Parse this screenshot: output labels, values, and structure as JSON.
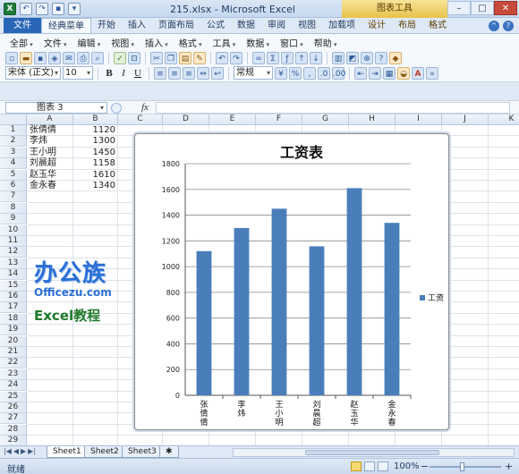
{
  "window": {
    "title": "215.xlsx - Microsoft Excel",
    "context_tab_group": "图表工具"
  },
  "ribbon_tabs": [
    {
      "label": "文件",
      "kind": "file"
    },
    {
      "label": "经典菜单",
      "kind": "active"
    },
    {
      "label": "开始",
      "kind": ""
    },
    {
      "label": "插入",
      "kind": ""
    },
    {
      "label": "页面布局",
      "kind": ""
    },
    {
      "label": "公式",
      "kind": ""
    },
    {
      "label": "数据",
      "kind": ""
    },
    {
      "label": "审阅",
      "kind": ""
    },
    {
      "label": "视图",
      "kind": ""
    },
    {
      "label": "加载项",
      "kind": ""
    },
    {
      "label": "设计",
      "kind": "ctx"
    },
    {
      "label": "布局",
      "kind": "ctx"
    },
    {
      "label": "格式",
      "kind": "ctx"
    }
  ],
  "classic_menu": [
    "全部",
    "文件",
    "编辑",
    "视图",
    "插入",
    "格式",
    "工具",
    "数据",
    "窗口",
    "帮助"
  ],
  "format_toolbar": {
    "font_name": "宋体 (正文)",
    "font_size": "10",
    "number_format": "常规",
    "bold_label": "B",
    "italic_label": "I",
    "underline_label": "U"
  },
  "formula_bar": {
    "name_box": "图表 3",
    "fx_label": "fx",
    "formula": ""
  },
  "grid": {
    "columns": [
      "A",
      "B",
      "C",
      "D",
      "E",
      "F",
      "G",
      "H",
      "I",
      "J",
      "K"
    ],
    "rows": [
      "1",
      "2",
      "3",
      "4",
      "5",
      "6",
      "7",
      "8",
      "9",
      "10",
      "11",
      "12",
      "13",
      "14",
      "15",
      "16",
      "17",
      "18",
      "19",
      "20",
      "21",
      "22",
      "23",
      "24",
      "25",
      "26",
      "27",
      "28",
      "29"
    ],
    "data": [
      {
        "name": "张倩倩",
        "salary": "1120"
      },
      {
        "name": "李炜",
        "salary": "1300"
      },
      {
        "name": "王小明",
        "salary": "1450"
      },
      {
        "name": "刘晨超",
        "salary": "1158"
      },
      {
        "name": "赵玉华",
        "salary": "1610"
      },
      {
        "name": "金永春",
        "salary": "1340"
      }
    ]
  },
  "watermark": {
    "line1": "办公族",
    "line2": "Officezu.com",
    "line3": "Excel教程"
  },
  "chart_data": {
    "type": "bar",
    "title": "工资表",
    "categories": [
      "张倩倩",
      "李炜",
      "王小明",
      "刘晨超",
      "赵玉华",
      "金永春"
    ],
    "series": [
      {
        "name": "工资",
        "values": [
          1120,
          1300,
          1450,
          1158,
          1610,
          1340
        ],
        "color": "#4a7ebb"
      }
    ],
    "y_ticks": [
      "0",
      "200",
      "400",
      "600",
      "800",
      "1000",
      "1200",
      "1400",
      "1600",
      "1800"
    ],
    "ylim": [
      0,
      1800
    ],
    "grid": true,
    "legend": "right"
  },
  "sheet_tabs": [
    "Sheet1",
    "Sheet2",
    "Sheet3"
  ],
  "status": {
    "ready": "就绪",
    "zoom": "100%",
    "minus": "−",
    "plus": "+"
  }
}
